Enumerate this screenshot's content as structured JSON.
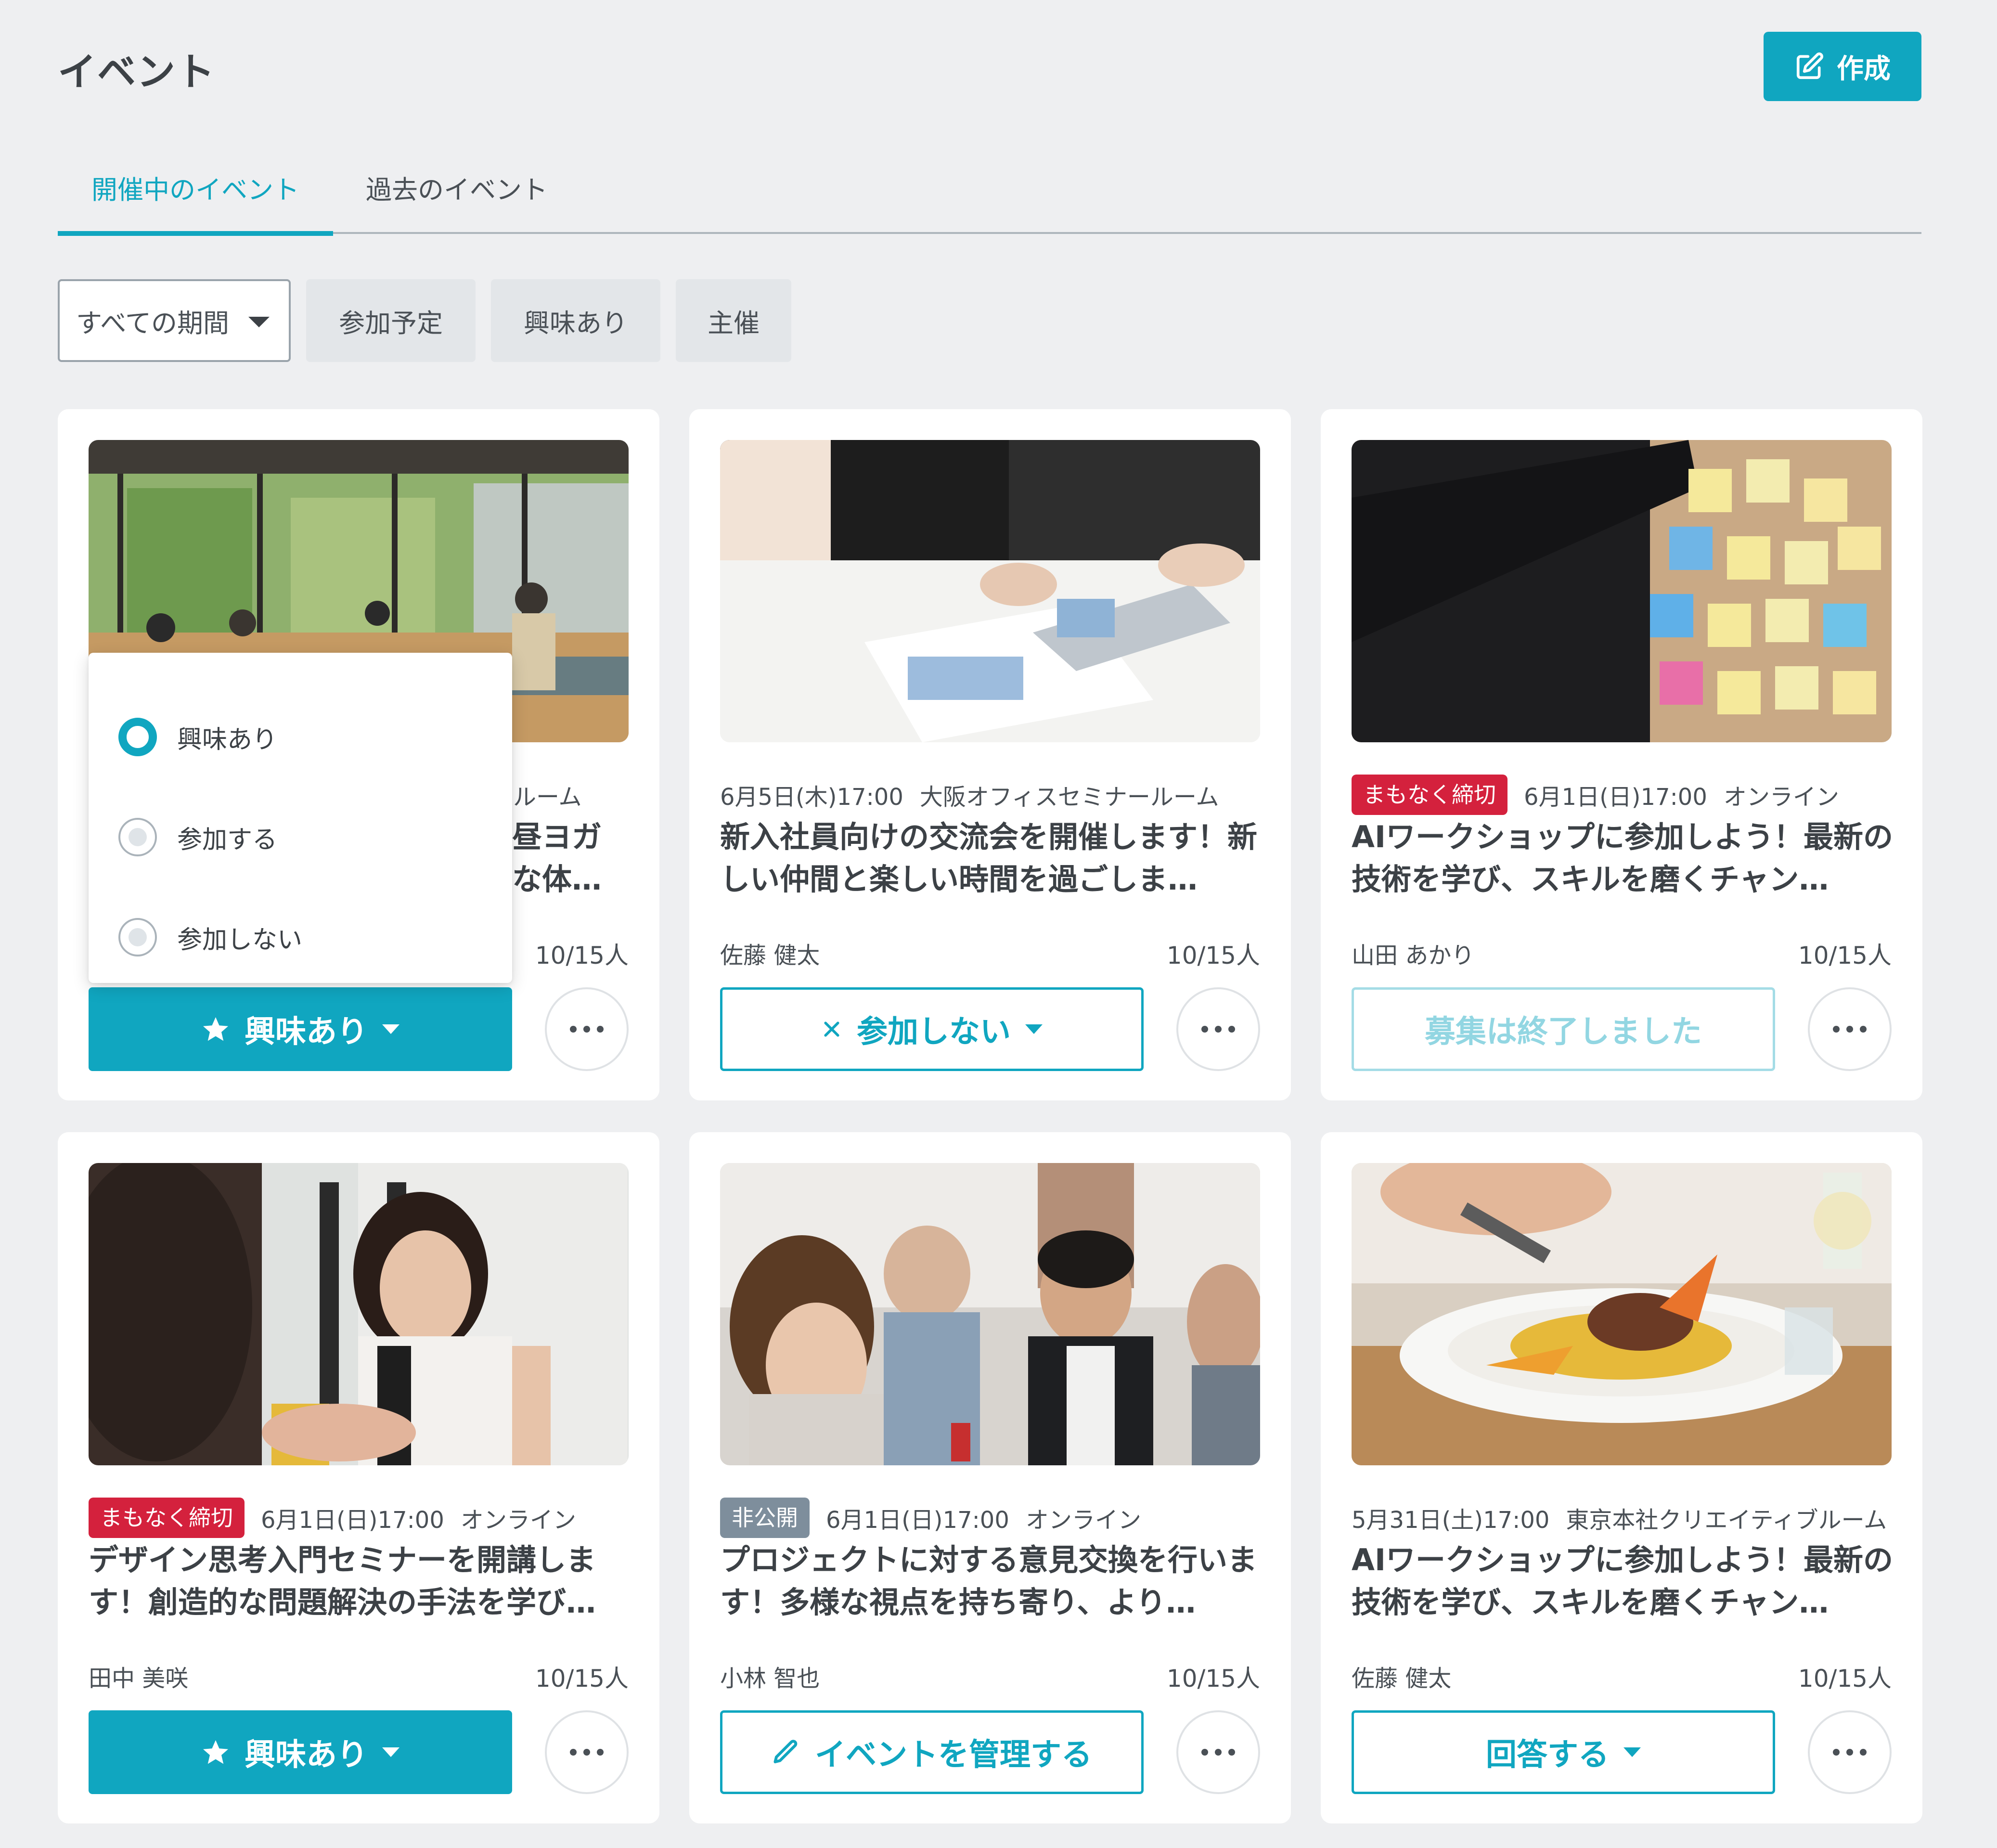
{
  "header": {
    "title": "イベント",
    "create_label": "作成"
  },
  "tabs": [
    {
      "label": "開催中のイベント",
      "active": true
    },
    {
      "label": "過去のイベント",
      "active": false
    }
  ],
  "filters": {
    "period": "すべての期間",
    "chips": [
      "参加予定",
      "興味あり",
      "主催"
    ]
  },
  "colors": {
    "accent": "#10a6c0",
    "badge_red": "#d4213d",
    "badge_gray": "#7e8e9c",
    "background": "#eeeff1"
  },
  "cards": [
    {
      "badge": "",
      "date": "",
      "location": "ールーム",
      "title": "昼ヨガ\nな体…",
      "organizer": "",
      "count": "10/15人",
      "action": "興味あり",
      "action_icon": "star-icon",
      "action_style": "solid"
    },
    {
      "badge": "",
      "date": "6月5日(木)17:00",
      "location": "大阪オフィスセミナールーム",
      "title": "新入社員向けの交流会を開催します！新しい仲間と楽しい時間を過ごしま…",
      "organizer": "佐藤 健太",
      "count": "10/15人",
      "action": "参加しない",
      "action_icon": "close-icon",
      "action_style": "outline"
    },
    {
      "badge": "まもなく締切",
      "date": "6月1日(日)17:00",
      "location": "オンライン",
      "title": "AIワークショップに参加しよう！最新の技術を学び、スキルを磨くチャン…",
      "organizer": "山田 あかり",
      "count": "10/15人",
      "action": "募集は終了しました",
      "action_icon": "",
      "action_style": "disabled"
    },
    {
      "badge": "まもなく締切",
      "date": "6月1日(日)17:00",
      "location": "オンライン",
      "title": "デザイン思考入門セミナーを開講します！創造的な問題解決の手法を学び…",
      "organizer": "田中 美咲",
      "count": "10/15人",
      "action": "興味あり",
      "action_icon": "star-icon",
      "action_style": "solid"
    },
    {
      "badge": "非公開",
      "date": "6月1日(日)17:00",
      "location": "オンライン",
      "title": "プロジェクトに対する意見交換を行います！多様な視点を持ち寄り、より…",
      "organizer": "小林 智也",
      "count": "10/15人",
      "action": "イベントを管理する",
      "action_icon": "pencil-icon",
      "action_style": "outline"
    },
    {
      "badge": "",
      "date": "5月31日(土)17:00",
      "location": "東京本社クリエイティブルーム",
      "title": "AIワークショップに参加しよう！最新の技術を学び、スキルを磨くチャン…",
      "organizer": "佐藤 健太",
      "count": "10/15人",
      "action": "回答する",
      "action_icon": "",
      "action_style": "outline"
    }
  ],
  "dropdown": {
    "options": [
      {
        "label": "興味あり",
        "selected": true
      },
      {
        "label": "参加する",
        "selected": false
      },
      {
        "label": "参加しない",
        "selected": false
      }
    ]
  }
}
